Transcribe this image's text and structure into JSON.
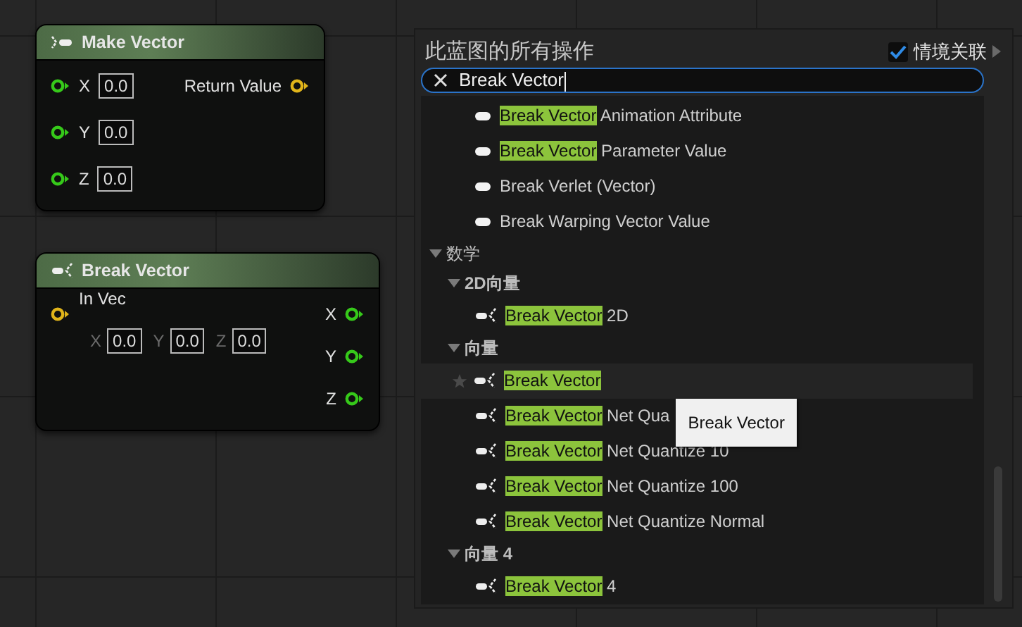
{
  "nodes": [
    {
      "kind": "make",
      "title": "Make Vector",
      "inputs": [
        {
          "kind": "float",
          "label": "X",
          "value": "0.0"
        },
        {
          "kind": "float",
          "label": "Y",
          "value": "0.0"
        },
        {
          "kind": "float",
          "label": "Z",
          "value": "0.0"
        }
      ],
      "outputs": [
        {
          "kind": "vector",
          "label": "Return Value"
        }
      ]
    },
    {
      "kind": "break",
      "title": "Break Vector",
      "inputs": [
        {
          "kind": "vector",
          "label": "In Vec",
          "fields": [
            {
              "label": "X",
              "value": "0.0"
            },
            {
              "label": "Y",
              "value": "0.0"
            },
            {
              "label": "Z",
              "value": "0.0"
            }
          ]
        }
      ],
      "outputs": [
        {
          "kind": "float",
          "label": "X"
        },
        {
          "kind": "float",
          "label": "Y"
        },
        {
          "kind": "float",
          "label": "Z"
        }
      ]
    }
  ],
  "menu": {
    "title": "此蓝图的所有操作",
    "context": {
      "label": "情境关联",
      "checked": true
    },
    "search": {
      "value": "Break Vector"
    },
    "tree": [
      {
        "kind": "function",
        "highlight": "Break Vector",
        "text": " Animation Attribute",
        "selected": false
      },
      {
        "kind": "function",
        "highlight": "Break Vector",
        "text": " Parameter Value",
        "selected": false
      },
      {
        "kind": "function",
        "text": "Break Verlet (Vector)",
        "selected": false
      },
      {
        "kind": "function",
        "text": "Break Warping Vector Value",
        "selected": false
      },
      {
        "kind": "category",
        "label": "数学",
        "expanded": true,
        "children": [
          {
            "kind": "category",
            "label": "2D向量",
            "expanded": true,
            "children": [
              {
                "kind": "break",
                "highlight": "Break Vector",
                "text": " 2D",
                "selected": false
              }
            ]
          },
          {
            "kind": "category",
            "label": "向量",
            "expanded": true,
            "children": [
              {
                "kind": "break",
                "highlight": "Break Vector",
                "selected": true
              },
              {
                "kind": "break",
                "highlight": "Break Vector",
                "text": " Net Qua",
                "selected": false,
                "tooltip": "Break Vector"
              },
              {
                "kind": "break",
                "highlight": "Break Vector",
                "text": " Net Quantize 10",
                "selected": false
              },
              {
                "kind": "break",
                "highlight": "Break Vector",
                "text": " Net Quantize 100",
                "selected": false
              },
              {
                "kind": "break",
                "highlight": "Break Vector",
                "text": " Net Quantize Normal",
                "selected": false
              }
            ]
          },
          {
            "kind": "category",
            "label": "向量 4",
            "expanded": true,
            "children": [
              {
                "kind": "break",
                "highlight": "Break Vector",
                "text": " 4",
                "selected": false
              }
            ]
          }
        ]
      }
    ]
  }
}
